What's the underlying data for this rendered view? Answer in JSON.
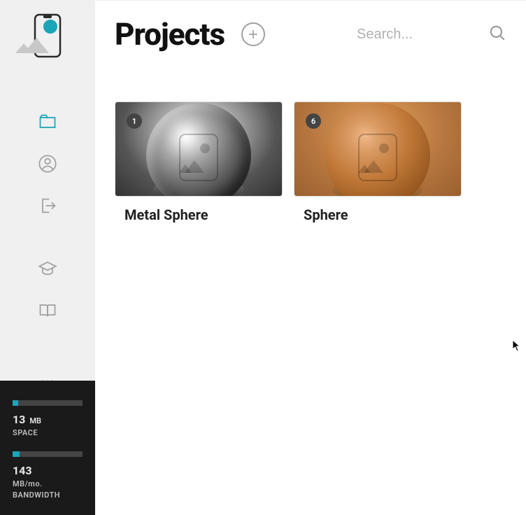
{
  "sidebar": {
    "logo_name": "app-logo",
    "nav": [
      {
        "name": "projects-icon",
        "active": true
      },
      {
        "name": "account-icon",
        "active": false
      },
      {
        "name": "logout-icon",
        "active": false
      },
      {
        "name": "learn-icon",
        "active": false
      },
      {
        "name": "docs-icon",
        "active": false
      },
      {
        "name": "bug-icon",
        "active": false
      },
      {
        "name": "feedback-icon",
        "active": false
      }
    ],
    "usage": {
      "space": {
        "value": "13",
        "unit": "MB",
        "label": "SPACE",
        "percent": 8
      },
      "bandwidth": {
        "value": "143",
        "unit": "MB/mo.",
        "label": "BANDWIDTH",
        "percent": 10
      }
    }
  },
  "header": {
    "title": "Projects",
    "add_tooltip": "Add project",
    "search_placeholder": "Search..."
  },
  "projects": [
    {
      "title": "Metal Sphere",
      "badge": "1",
      "variant": "metal"
    },
    {
      "title": "Sphere",
      "badge": "6",
      "variant": "clay"
    }
  ]
}
